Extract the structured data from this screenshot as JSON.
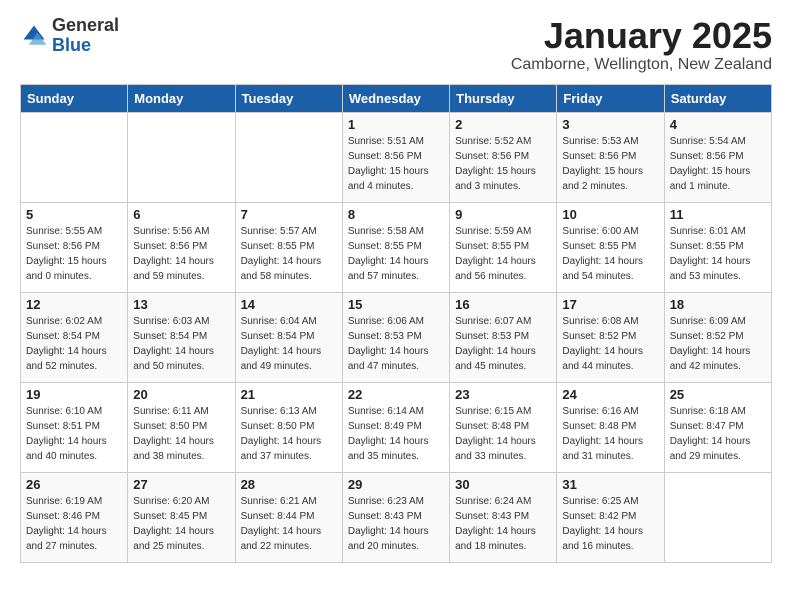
{
  "logo": {
    "general": "General",
    "blue": "Blue"
  },
  "header": {
    "title": "January 2025",
    "subtitle": "Camborne, Wellington, New Zealand"
  },
  "days_of_week": [
    "Sunday",
    "Monday",
    "Tuesday",
    "Wednesday",
    "Thursday",
    "Friday",
    "Saturday"
  ],
  "weeks": [
    [
      {
        "day": "",
        "info": ""
      },
      {
        "day": "",
        "info": ""
      },
      {
        "day": "",
        "info": ""
      },
      {
        "day": "1",
        "info": "Sunrise: 5:51 AM\nSunset: 8:56 PM\nDaylight: 15 hours\nand 4 minutes."
      },
      {
        "day": "2",
        "info": "Sunrise: 5:52 AM\nSunset: 8:56 PM\nDaylight: 15 hours\nand 3 minutes."
      },
      {
        "day": "3",
        "info": "Sunrise: 5:53 AM\nSunset: 8:56 PM\nDaylight: 15 hours\nand 2 minutes."
      },
      {
        "day": "4",
        "info": "Sunrise: 5:54 AM\nSunset: 8:56 PM\nDaylight: 15 hours\nand 1 minute."
      }
    ],
    [
      {
        "day": "5",
        "info": "Sunrise: 5:55 AM\nSunset: 8:56 PM\nDaylight: 15 hours\nand 0 minutes."
      },
      {
        "day": "6",
        "info": "Sunrise: 5:56 AM\nSunset: 8:56 PM\nDaylight: 14 hours\nand 59 minutes."
      },
      {
        "day": "7",
        "info": "Sunrise: 5:57 AM\nSunset: 8:55 PM\nDaylight: 14 hours\nand 58 minutes."
      },
      {
        "day": "8",
        "info": "Sunrise: 5:58 AM\nSunset: 8:55 PM\nDaylight: 14 hours\nand 57 minutes."
      },
      {
        "day": "9",
        "info": "Sunrise: 5:59 AM\nSunset: 8:55 PM\nDaylight: 14 hours\nand 56 minutes."
      },
      {
        "day": "10",
        "info": "Sunrise: 6:00 AM\nSunset: 8:55 PM\nDaylight: 14 hours\nand 54 minutes."
      },
      {
        "day": "11",
        "info": "Sunrise: 6:01 AM\nSunset: 8:55 PM\nDaylight: 14 hours\nand 53 minutes."
      }
    ],
    [
      {
        "day": "12",
        "info": "Sunrise: 6:02 AM\nSunset: 8:54 PM\nDaylight: 14 hours\nand 52 minutes."
      },
      {
        "day": "13",
        "info": "Sunrise: 6:03 AM\nSunset: 8:54 PM\nDaylight: 14 hours\nand 50 minutes."
      },
      {
        "day": "14",
        "info": "Sunrise: 6:04 AM\nSunset: 8:54 PM\nDaylight: 14 hours\nand 49 minutes."
      },
      {
        "day": "15",
        "info": "Sunrise: 6:06 AM\nSunset: 8:53 PM\nDaylight: 14 hours\nand 47 minutes."
      },
      {
        "day": "16",
        "info": "Sunrise: 6:07 AM\nSunset: 8:53 PM\nDaylight: 14 hours\nand 45 minutes."
      },
      {
        "day": "17",
        "info": "Sunrise: 6:08 AM\nSunset: 8:52 PM\nDaylight: 14 hours\nand 44 minutes."
      },
      {
        "day": "18",
        "info": "Sunrise: 6:09 AM\nSunset: 8:52 PM\nDaylight: 14 hours\nand 42 minutes."
      }
    ],
    [
      {
        "day": "19",
        "info": "Sunrise: 6:10 AM\nSunset: 8:51 PM\nDaylight: 14 hours\nand 40 minutes."
      },
      {
        "day": "20",
        "info": "Sunrise: 6:11 AM\nSunset: 8:50 PM\nDaylight: 14 hours\nand 38 minutes."
      },
      {
        "day": "21",
        "info": "Sunrise: 6:13 AM\nSunset: 8:50 PM\nDaylight: 14 hours\nand 37 minutes."
      },
      {
        "day": "22",
        "info": "Sunrise: 6:14 AM\nSunset: 8:49 PM\nDaylight: 14 hours\nand 35 minutes."
      },
      {
        "day": "23",
        "info": "Sunrise: 6:15 AM\nSunset: 8:48 PM\nDaylight: 14 hours\nand 33 minutes."
      },
      {
        "day": "24",
        "info": "Sunrise: 6:16 AM\nSunset: 8:48 PM\nDaylight: 14 hours\nand 31 minutes."
      },
      {
        "day": "25",
        "info": "Sunrise: 6:18 AM\nSunset: 8:47 PM\nDaylight: 14 hours\nand 29 minutes."
      }
    ],
    [
      {
        "day": "26",
        "info": "Sunrise: 6:19 AM\nSunset: 8:46 PM\nDaylight: 14 hours\nand 27 minutes."
      },
      {
        "day": "27",
        "info": "Sunrise: 6:20 AM\nSunset: 8:45 PM\nDaylight: 14 hours\nand 25 minutes."
      },
      {
        "day": "28",
        "info": "Sunrise: 6:21 AM\nSunset: 8:44 PM\nDaylight: 14 hours\nand 22 minutes."
      },
      {
        "day": "29",
        "info": "Sunrise: 6:23 AM\nSunset: 8:43 PM\nDaylight: 14 hours\nand 20 minutes."
      },
      {
        "day": "30",
        "info": "Sunrise: 6:24 AM\nSunset: 8:43 PM\nDaylight: 14 hours\nand 18 minutes."
      },
      {
        "day": "31",
        "info": "Sunrise: 6:25 AM\nSunset: 8:42 PM\nDaylight: 14 hours\nand 16 minutes."
      },
      {
        "day": "",
        "info": ""
      }
    ]
  ]
}
